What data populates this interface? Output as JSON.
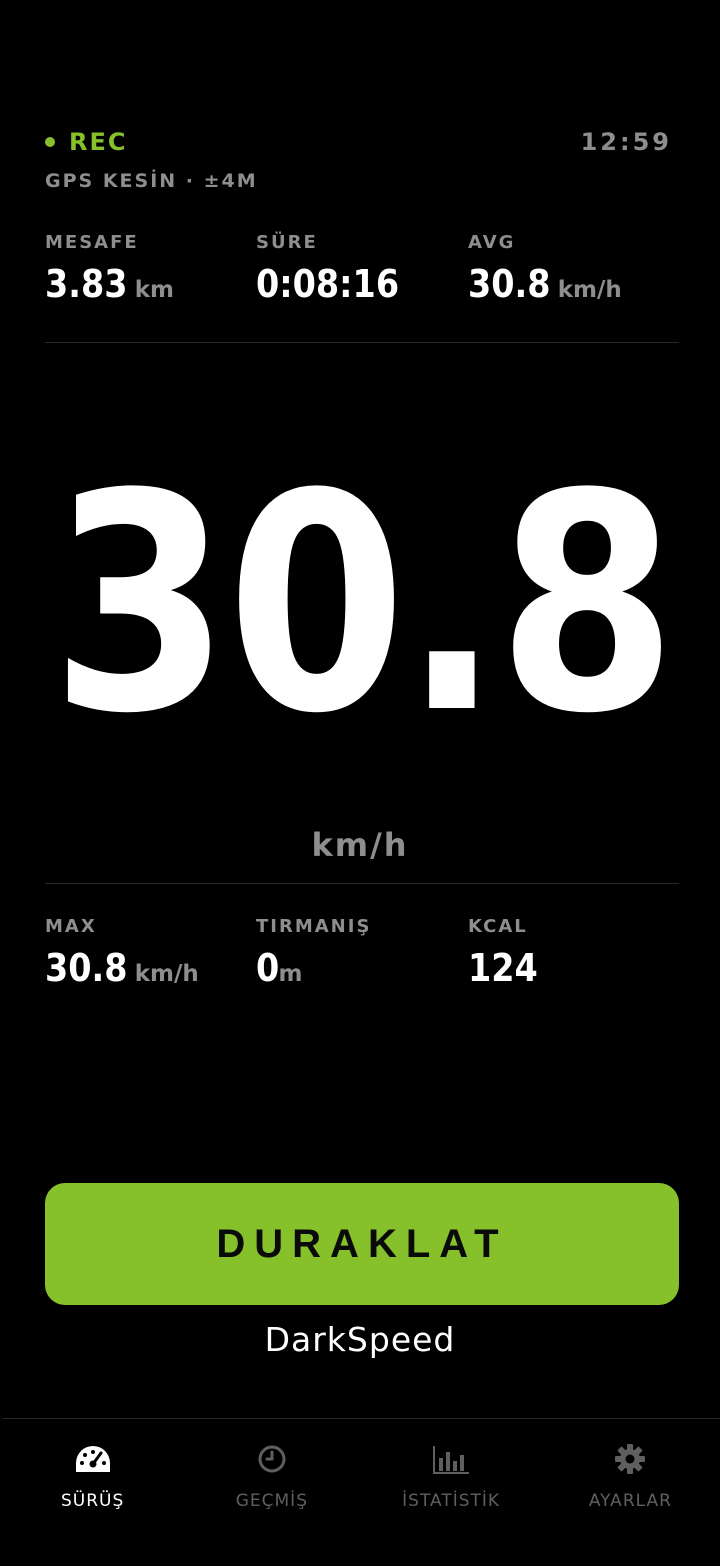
{
  "status": {
    "rec_label": "REC",
    "time": "12:59",
    "gps": "GPS KESİN · ±4M"
  },
  "top_metrics": [
    {
      "label": "MESAFE",
      "value": "3.83",
      "unit": "km"
    },
    {
      "label": "SÜRE",
      "value": "0:08:16",
      "unit": ""
    },
    {
      "label": "AVG",
      "value": "30.8",
      "unit": "km/h"
    }
  ],
  "speed": {
    "value": "30.8",
    "unit": "km/h"
  },
  "bottom_metrics": [
    {
      "label": "MAX",
      "value": "30.8",
      "unit": "km/h"
    },
    {
      "label": "TIRMANIŞ",
      "value": "0",
      "unit": "m"
    },
    {
      "label": "KCAL",
      "value": "124",
      "unit": ""
    }
  ],
  "pause_button": {
    "label": "DURAKLAT"
  },
  "brand": "DarkSpeed",
  "nav": {
    "items": [
      {
        "label": "SÜRÜŞ",
        "icon": "speedometer-icon",
        "active": true
      },
      {
        "label": "GEÇMİŞ",
        "icon": "clock-icon",
        "active": false
      },
      {
        "label": "İSTATİSTİK",
        "icon": "bar-chart-icon",
        "active": false
      },
      {
        "label": "AYARLAR",
        "icon": "gear-icon",
        "active": false
      }
    ]
  },
  "colors": {
    "accent": "#86c02a",
    "muted": "#8e8e8e",
    "inactive_nav": "#5f5f5f",
    "background": "#000000"
  }
}
